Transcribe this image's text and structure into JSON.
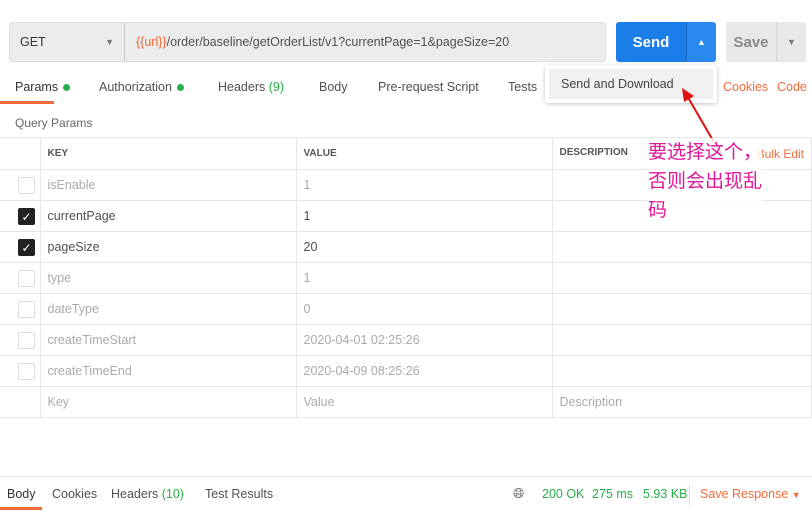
{
  "request": {
    "method": "GET",
    "url_var": "{{url}}",
    "url_path": "/order/baseline/getOrderList/v1?currentPage=1&pageSize=20",
    "send_label": "Send",
    "save_label": "Save"
  },
  "dropdown": {
    "item": "Send and Download"
  },
  "tabs": [
    {
      "label": "Params",
      "dot": true
    },
    {
      "label": "Authorization",
      "dot": true
    },
    {
      "label": "Headers",
      "count": "(9)"
    },
    {
      "label": "Body"
    },
    {
      "label": "Pre-request Script"
    },
    {
      "label": "Tests"
    }
  ],
  "links": {
    "cookies": "Cookies",
    "code": "Code"
  },
  "query_params_title": "Query Params",
  "table": {
    "headers": [
      "KEY",
      "VALUE",
      "DESCRIPTION"
    ],
    "bulk_edit": "Bulk Edit",
    "rows": [
      {
        "key": "isEnable",
        "value": "1",
        "checked": false
      },
      {
        "key": "currentPage",
        "value": "1",
        "checked": true
      },
      {
        "key": "pageSize",
        "value": "20",
        "checked": true
      },
      {
        "key": "type",
        "value": "1",
        "checked": false
      },
      {
        "key": "dateType",
        "value": "0",
        "checked": false
      },
      {
        "key": "createTimeStart",
        "value": "2020-04-01 02:25:26",
        "checked": false
      },
      {
        "key": "createTimeEnd",
        "value": "2020-04-09 08:25:26",
        "checked": false
      }
    ],
    "placeholders": {
      "key": "Key",
      "value": "Value",
      "description": "Description"
    }
  },
  "annotation": {
    "line1": "要选择这个，",
    "line2": "否则会出现乱",
    "line3": "码",
    "color": "#e0169a"
  },
  "response": {
    "tabs": [
      "Body",
      "Cookies",
      "Headers",
      "Test Results"
    ],
    "headers_count": "(10)",
    "status": "200 OK",
    "time": "275 ms",
    "size": "5.93 KB",
    "save_response": "Save Response"
  },
  "colors": {
    "accent": "#f26b3a",
    "send": "#1a7de8",
    "success": "#26b047"
  }
}
